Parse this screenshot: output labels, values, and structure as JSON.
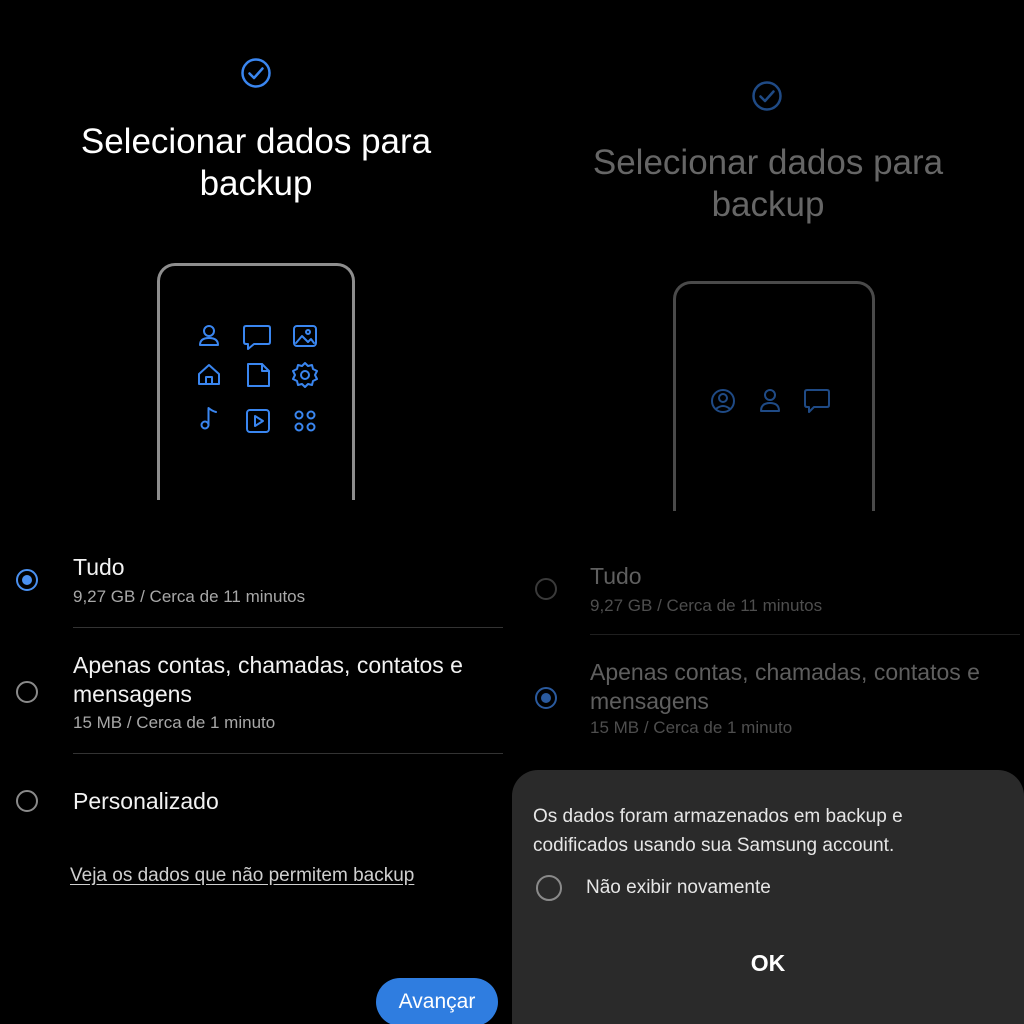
{
  "left": {
    "title": "Selecionar dados para backup",
    "options": [
      {
        "label": "Tudo",
        "detail": "9,27 GB / Cerca de 11 minutos",
        "selected": true
      },
      {
        "label": "Apenas contas, chamadas, contatos e mensagens",
        "detail": "15 MB / Cerca de 1 minuto",
        "selected": false
      },
      {
        "label": "Personalizado",
        "detail": "",
        "selected": false
      }
    ],
    "link": "Veja os dados que não permitem backup",
    "next_button": "Avançar",
    "phone_icons": [
      "person-icon",
      "chat-icon",
      "image-icon",
      "home-icon",
      "file-icon",
      "settings-icon",
      "music-icon",
      "play-icon",
      "apps-icon"
    ]
  },
  "right": {
    "title": "Selecionar dados para backup",
    "options": [
      {
        "label": "Tudo",
        "detail": "9,27 GB / Cerca de 11 minutos",
        "selected": false
      },
      {
        "label": "Apenas contas, chamadas, contatos e mensagens",
        "detail": "15 MB / Cerca de 1 minuto",
        "selected": true
      }
    ],
    "phone_icons": [
      "account-circle-icon",
      "person-icon",
      "chat-icon"
    ],
    "dialog": {
      "message": "Os dados foram armazenados em backup e codificados usando sua Samsung account.",
      "checkbox_label": "Não exibir novamente",
      "ok": "OK"
    }
  },
  "colors": {
    "accent": "#4a90f0",
    "button": "#2f7de0",
    "dialog_bg": "#2a2a2a"
  }
}
